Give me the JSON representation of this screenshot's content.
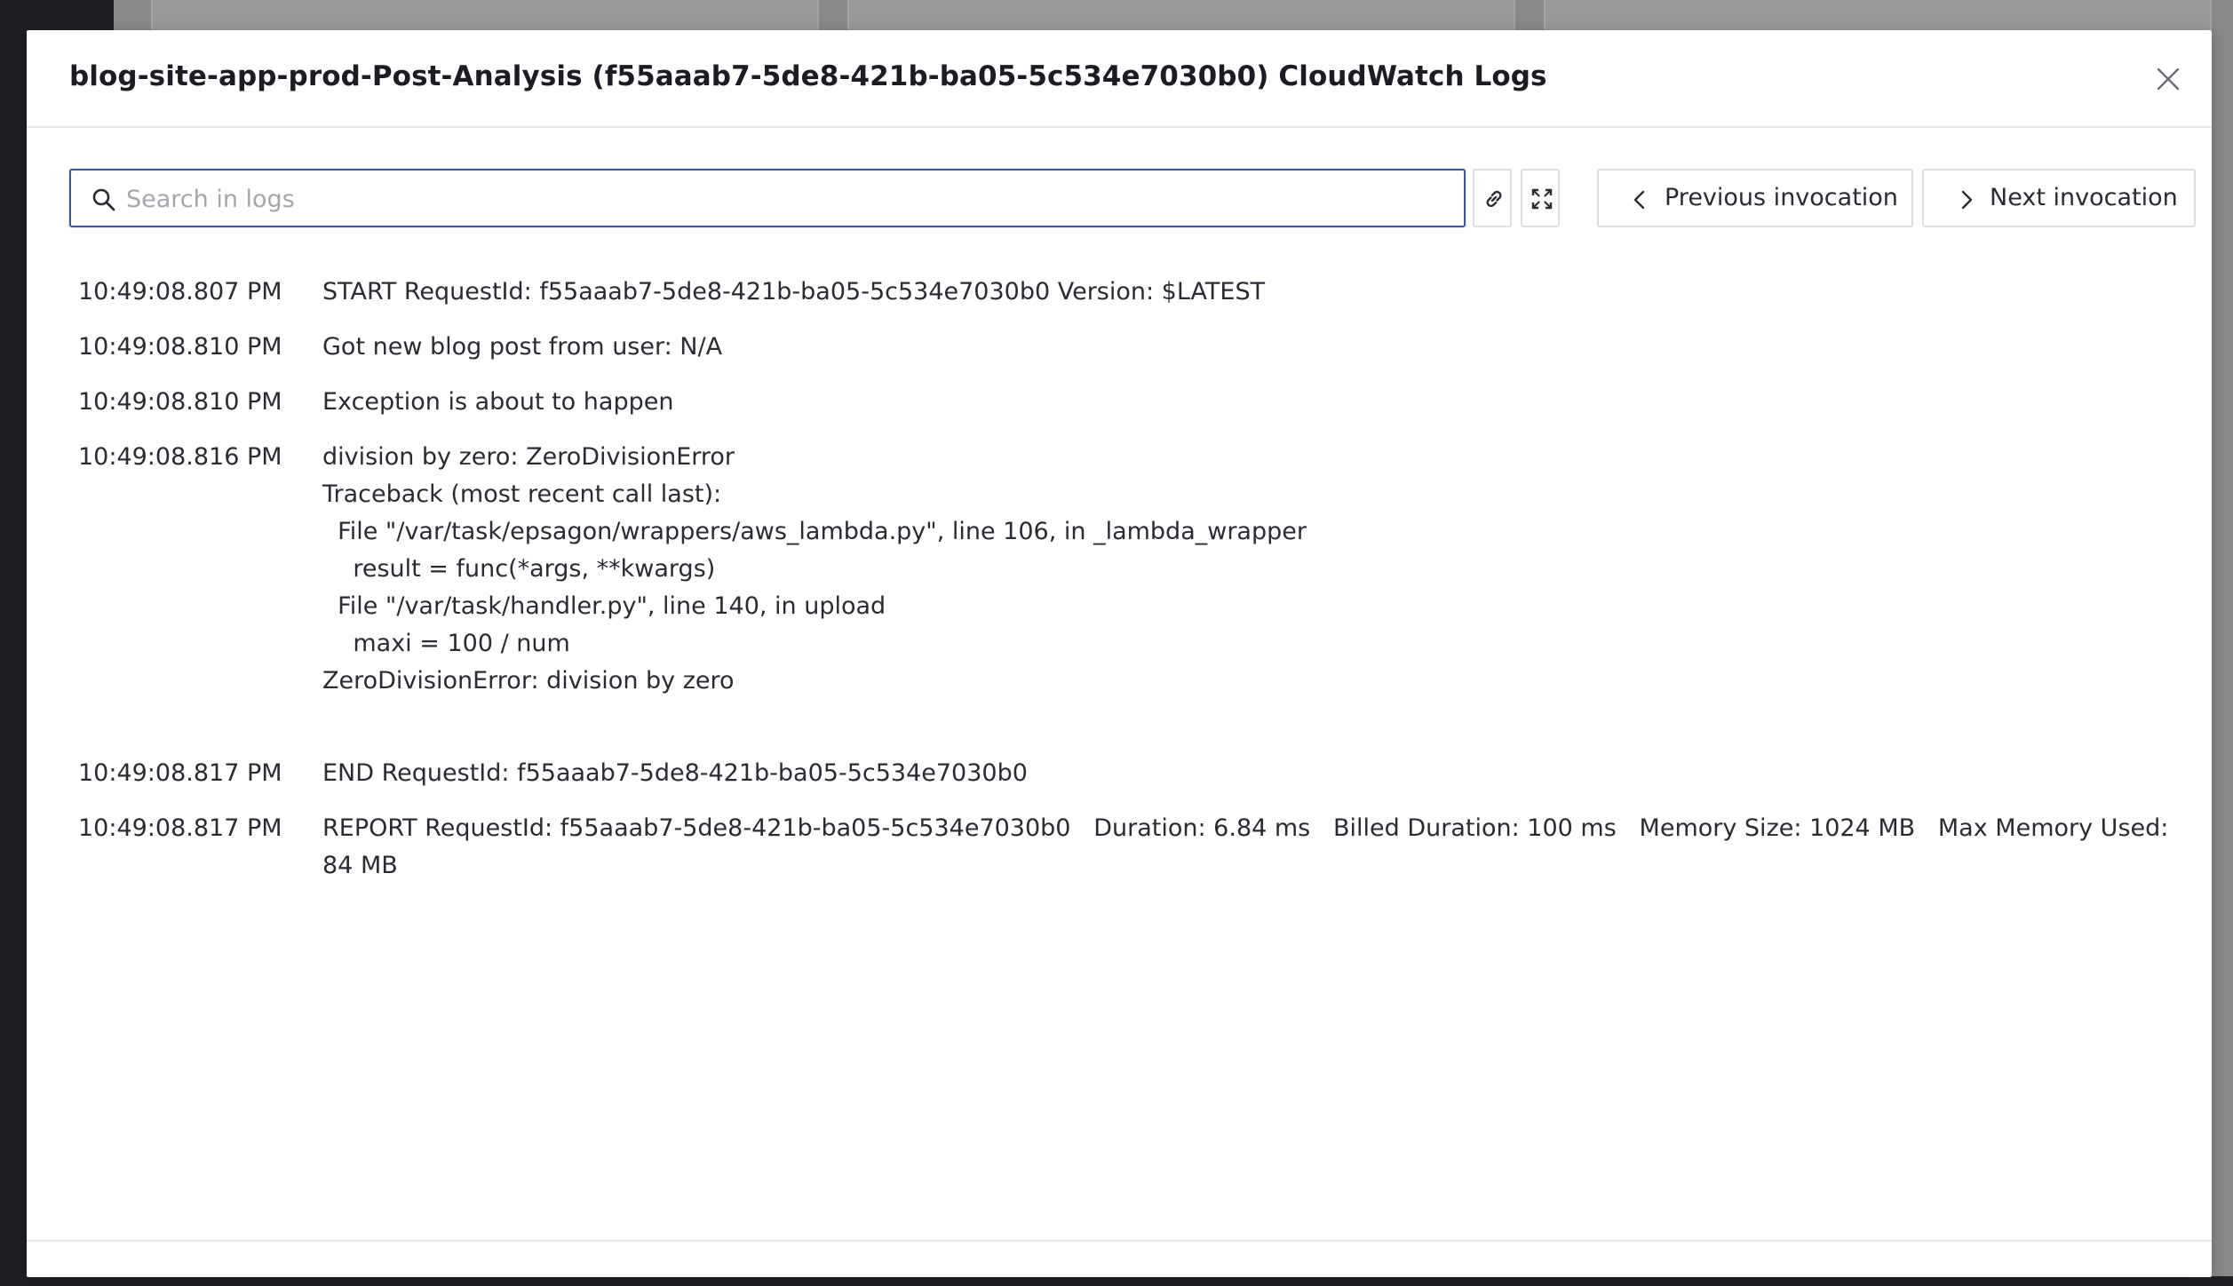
{
  "modal": {
    "title": "blog-site-app-prod-Post-Analysis (f55aaab7-5de8-421b-ba05-5c534e7030b0) CloudWatch Logs"
  },
  "search": {
    "placeholder": "Search in logs",
    "value": ""
  },
  "toolbar": {
    "copy_link_icon": "link-icon",
    "fullscreen_icon": "expand-icon",
    "previous_label": "Previous invocation",
    "next_label": "Next invocation"
  },
  "logs": [
    {
      "time": "10:49:08.807 PM",
      "message": "START RequestId: f55aaab7-5de8-421b-ba05-5c534e7030b0 Version: $LATEST"
    },
    {
      "time": "10:49:08.810 PM",
      "message": "Got new blog post from user: N/A"
    },
    {
      "time": "10:49:08.810 PM",
      "message": "Exception is about to happen"
    },
    {
      "time": "10:49:08.816 PM",
      "message": "division by zero: ZeroDivisionError\nTraceback (most recent call last):\n  File \"/var/task/epsagon/wrappers/aws_lambda.py\", line 106, in _lambda_wrapper\n    result = func(*args, **kwargs)\n  File \"/var/task/handler.py\", line 140, in upload\n    maxi = 100 / num\nZeroDivisionError: division by zero"
    },
    {
      "time": "10:49:08.817 PM",
      "message": "END RequestId: f55aaab7-5de8-421b-ba05-5c534e7030b0"
    },
    {
      "time": "10:49:08.817 PM",
      "message": "REPORT RequestId: f55aaab7-5de8-421b-ba05-5c534e7030b0   Duration: 6.84 ms   Billed Duration: 100 ms   Memory Size: 1024 MB   Max Memory Used: 84 MB"
    }
  ],
  "colors": {
    "accent": "#3b5998",
    "text": "#2a2b33",
    "border": "#dcdde2"
  }
}
